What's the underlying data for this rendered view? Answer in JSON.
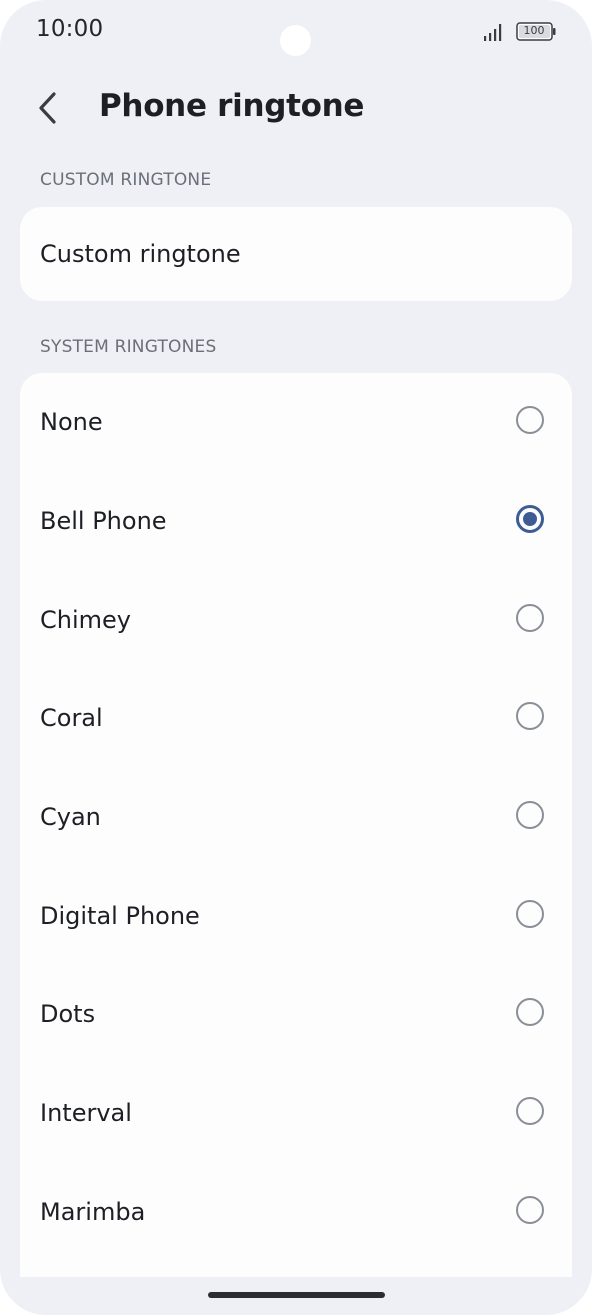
{
  "status_bar": {
    "time": "10:00",
    "battery": "100"
  },
  "app_bar": {
    "title": "Phone ringtone",
    "back_icon": "chevron-left-icon"
  },
  "custom_section": {
    "header": "CUSTOM RINGTONE",
    "item_label": "Custom ringtone"
  },
  "system_section": {
    "header": "SYSTEM RINGTONES",
    "items": [
      {
        "label": "None",
        "selected": false
      },
      {
        "label": "Bell Phone",
        "selected": true
      },
      {
        "label": "Chimey",
        "selected": false
      },
      {
        "label": "Coral",
        "selected": false
      },
      {
        "label": "Cyan",
        "selected": false
      },
      {
        "label": "Digital Phone",
        "selected": false
      },
      {
        "label": "Dots",
        "selected": false
      },
      {
        "label": "Interval",
        "selected": false
      },
      {
        "label": "Marimba",
        "selected": false
      }
    ]
  },
  "colors": {
    "background": "#eef0f5",
    "card": "#fdfdfe",
    "accent": "#3d5c93",
    "radio_unselected": "#8a8e97"
  }
}
